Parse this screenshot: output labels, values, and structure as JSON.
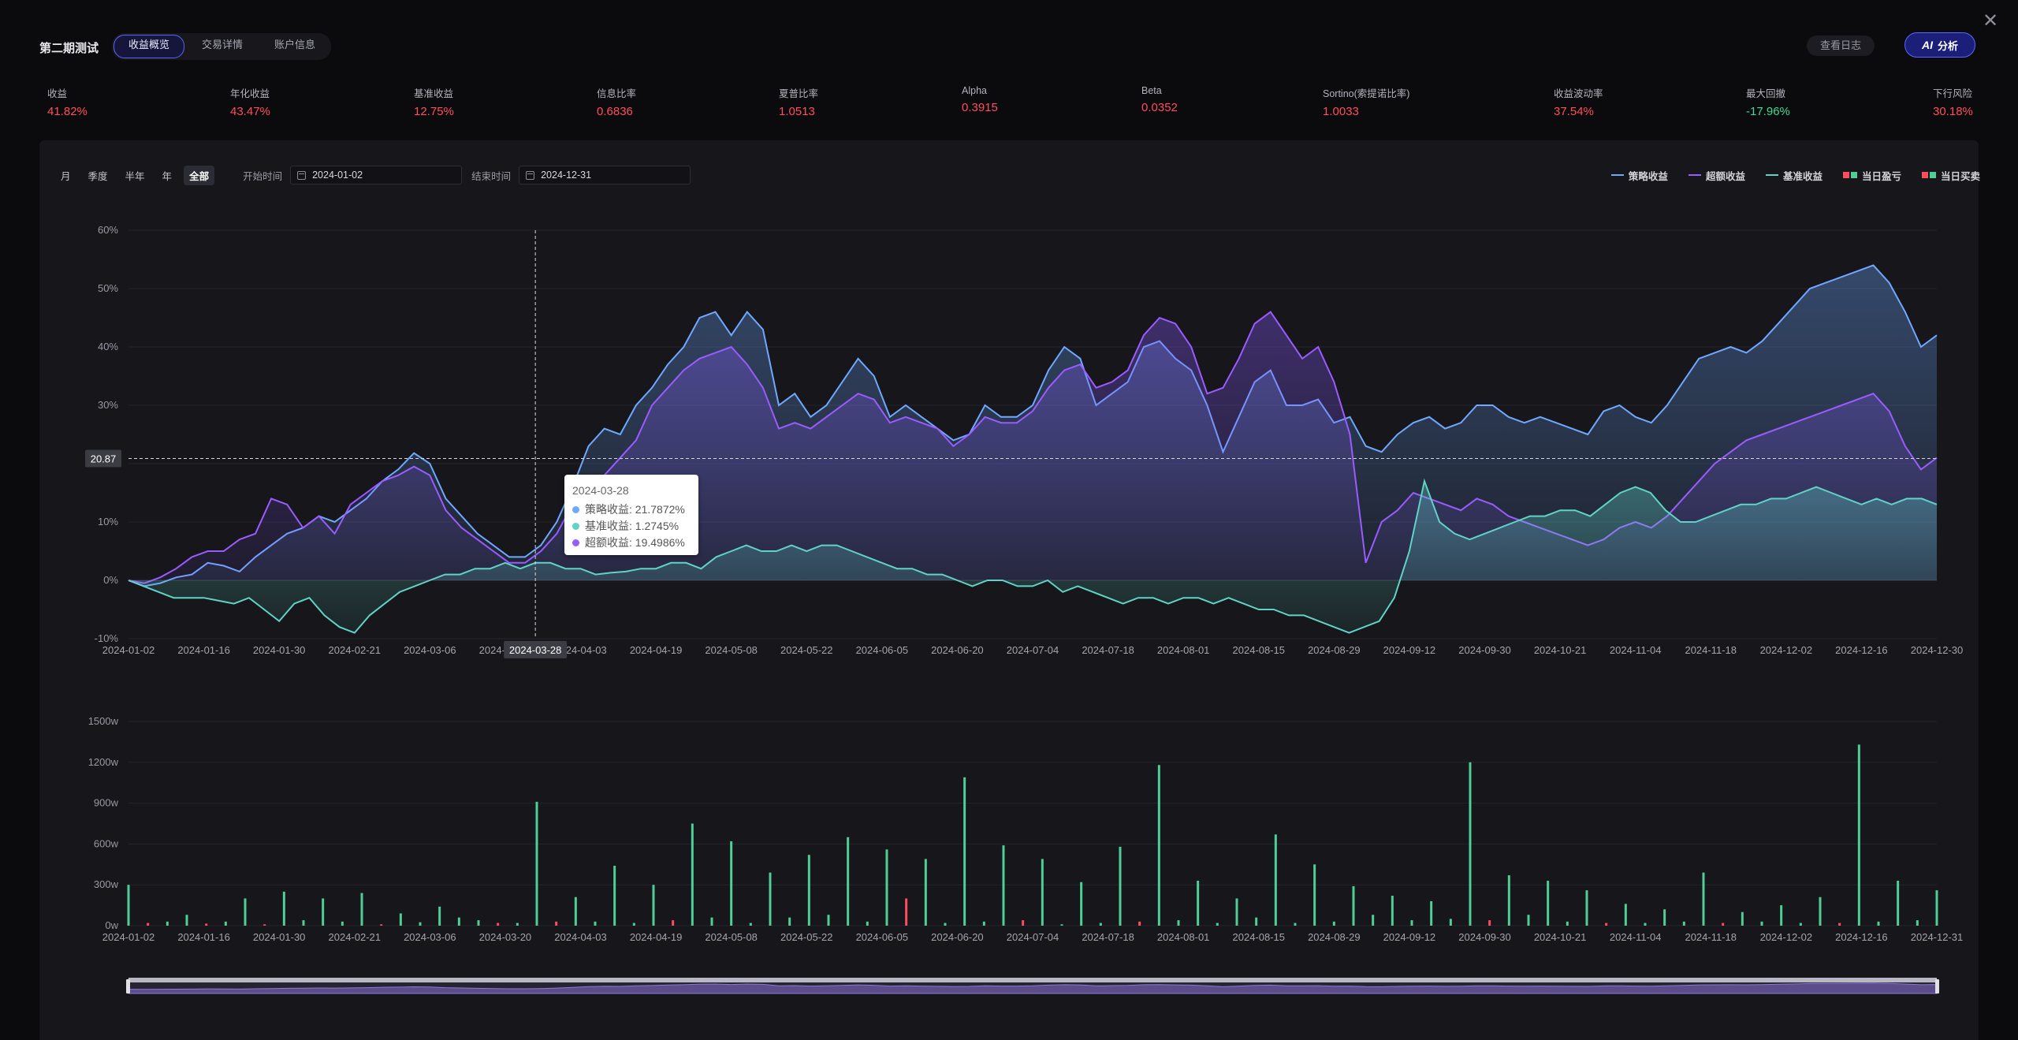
{
  "app": {
    "title": "第二期测试",
    "close_icon": "close-icon"
  },
  "tabs": [
    {
      "label": "收益概览",
      "active": true
    },
    {
      "label": "交易详情",
      "active": false
    },
    {
      "label": "账户信息",
      "active": false
    }
  ],
  "buttons": {
    "log": "查看日志",
    "ai": "分析",
    "ai_icon": "AI"
  },
  "metrics": [
    {
      "label": "收益",
      "value": "41.82%",
      "tone": "pos"
    },
    {
      "label": "年化收益",
      "value": "43.47%",
      "tone": "pos"
    },
    {
      "label": "基准收益",
      "value": "12.75%",
      "tone": "pos"
    },
    {
      "label": "信息比率",
      "value": "0.6836",
      "tone": "pos"
    },
    {
      "label": "夏普比率",
      "value": "1.0513",
      "tone": "pos"
    },
    {
      "label": "Alpha",
      "value": "0.3915",
      "tone": "pos"
    },
    {
      "label": "Beta",
      "value": "0.0352",
      "tone": "pos"
    },
    {
      "label": "Sortino(索提诺比率)",
      "value": "1.0033",
      "tone": "pos"
    },
    {
      "label": "收益波动率",
      "value": "37.54%",
      "tone": "pos"
    },
    {
      "label": "最大回撤",
      "value": "-17.96%",
      "tone": "neg"
    },
    {
      "label": "下行风险",
      "value": "30.18%",
      "tone": "pos"
    }
  ],
  "filters": {
    "periods": [
      {
        "label": "月"
      },
      {
        "label": "季度"
      },
      {
        "label": "半年"
      },
      {
        "label": "年"
      },
      {
        "label": "全部",
        "active": true
      }
    ],
    "start_label": "开始时间",
    "start_value": "2024-01-02",
    "end_label": "结束时间",
    "end_value": "2024-12-31"
  },
  "legend": [
    {
      "name": "策略收益",
      "kind": "line",
      "color": "#6fa8ff"
    },
    {
      "name": "超额收益",
      "kind": "line",
      "color": "#9a5cff"
    },
    {
      "name": "基准收益",
      "kind": "line",
      "color": "#5fd4c6"
    },
    {
      "name": "当日盈亏",
      "kind": "box",
      "colors": [
        "#ff4d5e",
        "#4fcf95"
      ]
    },
    {
      "name": "当日买卖",
      "kind": "box",
      "colors": [
        "#ff4d5e",
        "#4fcf95"
      ]
    }
  ],
  "colors": {
    "strategy": "#6fa8ff",
    "excess": "#9a5cff",
    "benchmark": "#5fd4c6",
    "bar_up": "#4fcf95",
    "bar_down": "#ff4d5e"
  },
  "tooltip": {
    "date": "2024-03-28",
    "rows": [
      {
        "label": "策略收益: 21.7872%",
        "color": "#6fa8ff"
      },
      {
        "label": "基准收益: 1.2745%",
        "color": "#5fd4c6"
      },
      {
        "label": "超额收益: 19.4986%",
        "color": "#9a5cff"
      }
    ]
  },
  "chart_data": [
    {
      "type": "line",
      "ylim": [
        -10,
        60
      ],
      "y_ticks": [
        "60%",
        "50%",
        "40%",
        "30%",
        "20%",
        "10%",
        "0%",
        "-10%"
      ],
      "x_ticks": [
        "2024-01-02",
        "2024-01-16",
        "2024-01-30",
        "2024-02-21",
        "2024-03-06",
        "2024-03-20",
        "2024-04-03",
        "2024-04-19",
        "2024-05-08",
        "2024-05-22",
        "2024-06-05",
        "2024-06-20",
        "2024-07-04",
        "2024-07-18",
        "2024-08-01",
        "2024-08-15",
        "2024-08-29",
        "2024-09-12",
        "2024-09-30",
        "2024-10-21",
        "2024-11-04",
        "2024-11-18",
        "2024-12-02",
        "2024-12-16",
        "2024-12-30"
      ],
      "crosshair": {
        "x_label": "2024-03-28",
        "y_label": "20.87",
        "x_index": 5.4,
        "y_value": 20.87
      },
      "series": [
        {
          "name": "策略收益",
          "values": [
            0,
            -1,
            -0.5,
            0.5,
            1,
            3,
            2.5,
            1.5,
            4,
            6,
            8,
            9,
            11,
            10,
            12,
            14,
            17,
            19,
            21.8,
            20,
            14,
            11,
            8,
            6,
            4,
            4,
            6,
            10,
            16,
            23,
            26,
            25,
            30,
            33,
            37,
            40,
            45,
            46,
            42,
            46,
            43,
            30,
            32,
            28,
            30,
            34,
            38,
            35,
            28,
            30,
            28,
            26,
            24,
            25,
            30,
            28,
            28,
            30,
            36,
            40,
            38,
            30,
            32,
            34,
            40,
            41,
            38,
            36,
            30,
            22,
            28,
            34,
            36,
            30,
            30,
            31,
            27,
            28,
            23,
            22,
            25,
            27,
            28,
            26,
            27,
            30,
            30,
            28,
            27,
            28,
            27,
            26,
            25,
            29,
            30,
            28,
            27,
            30,
            34,
            38,
            39,
            40,
            39,
            41,
            44,
            47,
            50,
            51,
            52,
            53,
            54,
            51,
            46,
            40,
            42
          ]
        },
        {
          "name": "超额收益",
          "values": [
            0,
            -0.5,
            0.5,
            2,
            4,
            5,
            5,
            7,
            8,
            14,
            13,
            9,
            11,
            8,
            13,
            15,
            17,
            18,
            19.5,
            18,
            12,
            9,
            7,
            5,
            3,
            3,
            5,
            8,
            13,
            15,
            18,
            21,
            24,
            30,
            33,
            36,
            38,
            39,
            40,
            37,
            33,
            26,
            27,
            26,
            28,
            30,
            32,
            31,
            27,
            28,
            27,
            26,
            23,
            25,
            28,
            27,
            27,
            29,
            33,
            36,
            37,
            33,
            34,
            36,
            42,
            45,
            44,
            40,
            32,
            33,
            38,
            44,
            46,
            42,
            38,
            40,
            34,
            25,
            3,
            10,
            12,
            15,
            14,
            13,
            12,
            14,
            13,
            11,
            10,
            9,
            8,
            7,
            6,
            7,
            9,
            10,
            9,
            11,
            14,
            17,
            20,
            22,
            24,
            25,
            26,
            27,
            28,
            29,
            30,
            31,
            32,
            29,
            23,
            19,
            21
          ]
        },
        {
          "name": "基准收益",
          "values": [
            0,
            -1,
            -2,
            -3,
            -3,
            -3,
            -3.5,
            -4,
            -3,
            -5,
            -7,
            -4,
            -3,
            -6,
            -8,
            -9,
            -6,
            -4,
            -2,
            -1,
            0,
            1,
            1,
            2,
            2,
            3,
            2,
            3,
            3,
            2,
            2,
            1,
            1.3,
            1.5,
            2,
            2,
            3,
            3,
            2,
            4,
            5,
            6,
            5,
            5,
            6,
            5,
            6,
            6,
            5,
            4,
            3,
            2,
            2,
            1,
            1,
            0,
            -1,
            0,
            0,
            -1,
            -1,
            0,
            -2,
            -1,
            -2,
            -3,
            -4,
            -3,
            -3,
            -4,
            -3,
            -3,
            -4,
            -3,
            -4,
            -5,
            -5,
            -6,
            -6,
            -7,
            -8,
            -9,
            -8,
            -7,
            -3,
            5,
            17,
            10,
            8,
            7,
            8,
            9,
            10,
            11,
            11,
            12,
            12,
            11,
            13,
            15,
            16,
            15,
            12,
            10,
            10,
            11,
            12,
            13,
            13,
            14,
            14,
            15,
            16,
            15,
            14,
            13,
            14,
            13,
            14,
            14,
            13
          ]
        }
      ]
    },
    {
      "type": "bar",
      "ylim": [
        0,
        1500
      ],
      "y_ticks": [
        "1500w",
        "1200w",
        "900w",
        "600w",
        "300w",
        "0w"
      ],
      "x_ticks": [
        "2024-01-02",
        "2024-01-16",
        "2024-01-30",
        "2024-02-21",
        "2024-03-06",
        "2024-03-20",
        "2024-04-03",
        "2024-04-19",
        "2024-05-08",
        "2024-05-22",
        "2024-06-05",
        "2024-06-20",
        "2024-07-04",
        "2024-07-18",
        "2024-08-01",
        "2024-08-15",
        "2024-08-29",
        "2024-09-12",
        "2024-09-30",
        "2024-10-21",
        "2024-11-04",
        "2024-11-18",
        "2024-12-02",
        "2024-12-16",
        "2024-12-31"
      ],
      "series": [
        {
          "name": "当日买卖",
          "values": [
            300,
            20,
            30,
            80,
            15,
            30,
            200,
            10,
            250,
            40,
            200,
            30,
            240,
            10,
            90,
            25,
            140,
            60,
            40,
            20,
            20,
            910,
            30,
            210,
            30,
            440,
            20,
            300,
            40,
            750,
            60,
            620,
            20,
            390,
            60,
            520,
            80,
            650,
            30,
            560,
            200,
            490,
            20,
            1090,
            30,
            590,
            40,
            490,
            10,
            320,
            20,
            580,
            30,
            1180,
            40,
            330,
            20,
            200,
            60,
            670,
            20,
            450,
            30,
            290,
            80,
            220,
            40,
            180,
            50,
            1200,
            40,
            370,
            80,
            330,
            30,
            260,
            20,
            160,
            20,
            120,
            30,
            390,
            20,
            100,
            30,
            150,
            20,
            210,
            20,
            1330,
            30,
            330,
            40,
            260
          ]
        }
      ]
    }
  ]
}
